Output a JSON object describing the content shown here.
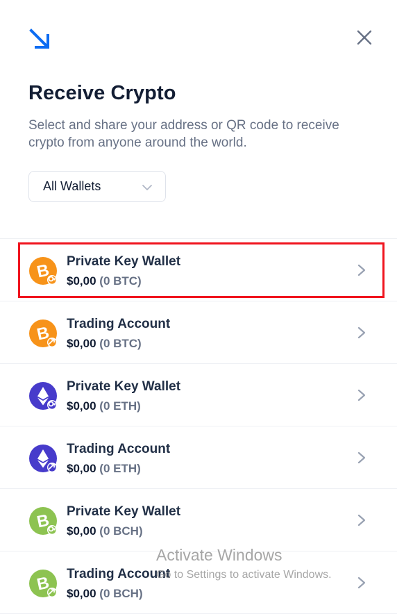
{
  "header": {
    "title": "Receive Crypto",
    "subtitle": "Select and share your address or QR code to receive crypto from anyone around the world.",
    "top_icon": "arrow-down-right-icon",
    "close_icon": "close-icon"
  },
  "filter": {
    "selected": "All Wallets"
  },
  "colors": {
    "accent": "#0c6cf2",
    "btc": "#f7931a",
    "eth": "#473bcb",
    "bch": "#8dc351",
    "highlight": "#f0141e"
  },
  "wallets": [
    {
      "name": "Private Key Wallet",
      "fiat": "$0,00",
      "crypto": "(0 BTC)",
      "coin": "btc",
      "badge": "key-icon",
      "highlighted": true
    },
    {
      "name": "Trading Account",
      "fiat": "$0,00",
      "crypto": "(0 BTC)",
      "coin": "btc",
      "badge": "exchange-icon",
      "highlighted": false
    },
    {
      "name": "Private Key Wallet",
      "fiat": "$0,00",
      "crypto": "(0 ETH)",
      "coin": "eth",
      "badge": "key-icon",
      "highlighted": false
    },
    {
      "name": "Trading Account",
      "fiat": "$0,00",
      "crypto": "(0 ETH)",
      "coin": "eth",
      "badge": "exchange-icon",
      "highlighted": false
    },
    {
      "name": "Private Key Wallet",
      "fiat": "$0,00",
      "crypto": "(0 BCH)",
      "coin": "bch",
      "badge": "key-icon",
      "highlighted": false
    },
    {
      "name": "Trading Account",
      "fiat": "$0,00",
      "crypto": "(0 BCH)",
      "coin": "bch",
      "badge": "exchange-icon",
      "highlighted": false
    }
  ],
  "watermark": {
    "line1": "Activate Windows",
    "line2": "Go to Settings to activate Windows."
  }
}
